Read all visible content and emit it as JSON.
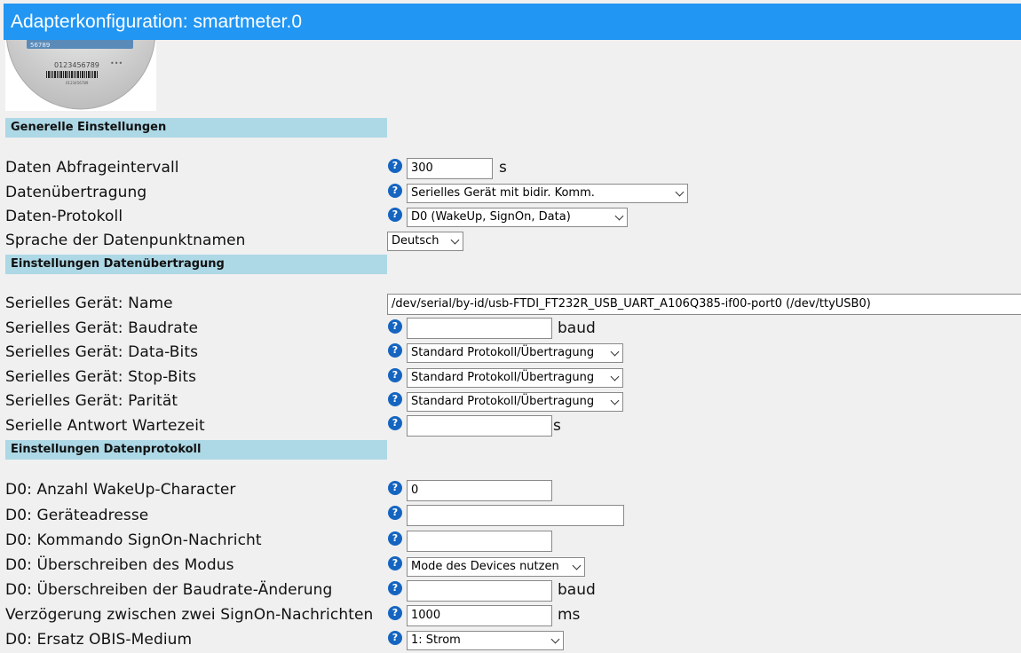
{
  "window": {
    "title": "Adapterkonfiguration: smartmeter.0"
  },
  "logo": {
    "meter_top": "56789",
    "meter_number": "0123456789",
    "meter_small": "0123456789",
    "meter_dots": "•••"
  },
  "sections": {
    "general": "Generelle Einstellungen",
    "transfer": "Einstellungen Datenübertragung",
    "protocol": "Einstellungen Datenprotokoll"
  },
  "general": {
    "interval_label": "Daten Abfrageintervall",
    "interval_value": "300",
    "interval_unit": "s",
    "transfer_label": "Datenübertragung",
    "transfer_value": "Serielles Gerät mit bidir. Komm.",
    "protocol_label": "Daten-Protokoll",
    "protocol_value": "D0 (WakeUp, SignOn, Data)",
    "language_label": "Sprache der Datenpunktnamen",
    "language_value": "Deutsch"
  },
  "transfer": {
    "device_name_label": "Serielles Gerät: Name",
    "device_name_value": "/dev/serial/by-id/usb-FTDI_FT232R_USB_UART_A106Q385-if00-port0 (/dev/ttyUSB0)",
    "baudrate_label": "Serielles Gerät: Baudrate",
    "baudrate_value": "",
    "baudrate_unit": "baud",
    "databits_label": "Serielles Gerät: Data-Bits",
    "databits_value": "Standard Protokoll/Übertragung",
    "stopbits_label": "Serielles Gerät: Stop-Bits",
    "stopbits_value": "Standard Protokoll/Übertragung",
    "parity_label": "Serielles Gerät: Parität",
    "parity_value": "Standard Protokoll/Übertragung",
    "wait_label": "Serielle Antwort Wartezeit",
    "wait_value": "",
    "wait_unit": "s"
  },
  "protocol": {
    "wakeup_label": "D0: Anzahl WakeUp-Character",
    "wakeup_value": "0",
    "address_label": "D0: Geräteadresse",
    "address_value": "",
    "signon_label": "D0: Kommando SignOn-Nachricht",
    "signon_value": "",
    "mode_label": "D0: Überschreiben des Modus",
    "mode_value": "Mode des Devices nutzen",
    "baudchange_label": "D0: Überschreiben der Baudrate-Änderung",
    "baudchange_value": "",
    "baudchange_unit": "baud",
    "delay_label": "Verzögerung zwischen zwei SignOn-Nachrichten",
    "delay_value": "1000",
    "delay_unit": "ms",
    "obis_label": "D0: Ersatz OBIS-Medium",
    "obis_value": "1: Strom"
  },
  "help_glyph": "?"
}
